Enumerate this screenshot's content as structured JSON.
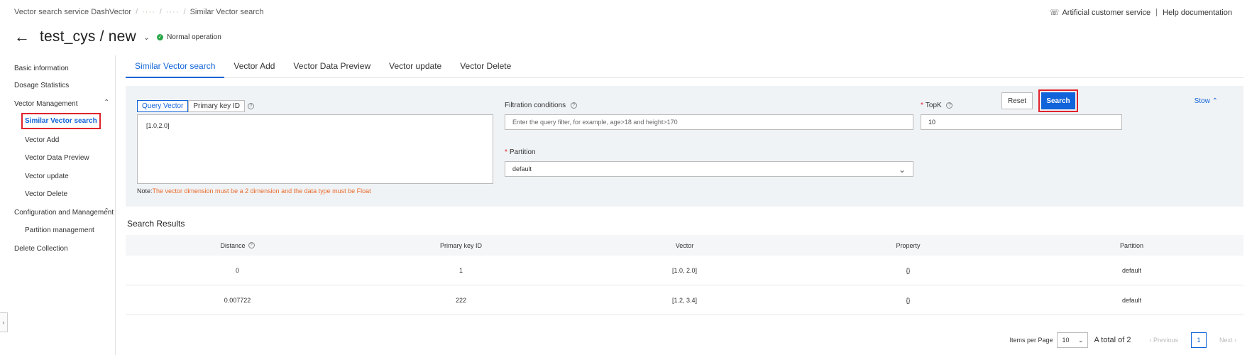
{
  "breadcrumb": {
    "root": "Vector search service DashVector",
    "blurred_1": "····",
    "blurred_2": "····",
    "current": "Similar Vector search"
  },
  "top_links": {
    "support": "Artificial customer service",
    "help": "Help documentation"
  },
  "header": {
    "title": "test_cys / new",
    "status": "Normal operation"
  },
  "sidebar": {
    "basic_info": "Basic information",
    "dosage": "Dosage Statistics",
    "vector_mgmt": "Vector Management",
    "similar_search": "Similar Vector search",
    "vector_add": "Vector Add",
    "vector_preview": "Vector Data Preview",
    "vector_update": "Vector update",
    "vector_delete": "Vector Delete",
    "config_mgmt": "Configuration and Management",
    "partition_mgmt": "Partition management",
    "delete_collection": "Delete Collection"
  },
  "tabs": [
    {
      "label": "Similar Vector search"
    },
    {
      "label": "Vector Add"
    },
    {
      "label": "Vector Data Preview"
    },
    {
      "label": "Vector update"
    },
    {
      "label": "Vector Delete"
    }
  ],
  "form": {
    "mode_query": "Query Vector",
    "mode_pk": "Primary key ID",
    "query_value": "[1.0,2.0]",
    "note_prefix": "Note:",
    "note_text": "The vector dimension must be a 2 dimension and the data type must be Float",
    "filter_label": "Filtration conditions",
    "filter_placeholder": "Enter the query filter, for example, age>18 and height>170",
    "topk_label": "TopK",
    "topk_value": "10",
    "partition_label": "Partition",
    "partition_value": "default",
    "stow": "Stow",
    "reset": "Reset",
    "search": "Search"
  },
  "results": {
    "title": "Search Results",
    "columns": [
      "Distance",
      "Primary key ID",
      "Vector",
      "Property",
      "Partition"
    ],
    "rows": [
      [
        "0",
        "1",
        "[1.0, 2.0]",
        "{}",
        "default"
      ],
      [
        "0.007722",
        "222",
        "[1.2, 3.4]",
        "{}",
        "default"
      ]
    ]
  },
  "pagination": {
    "items_per_page_label": "Items per Page",
    "page_size": "10",
    "total": "A total of 2",
    "previous": "Previous",
    "current_page": "1",
    "next": "Next"
  }
}
